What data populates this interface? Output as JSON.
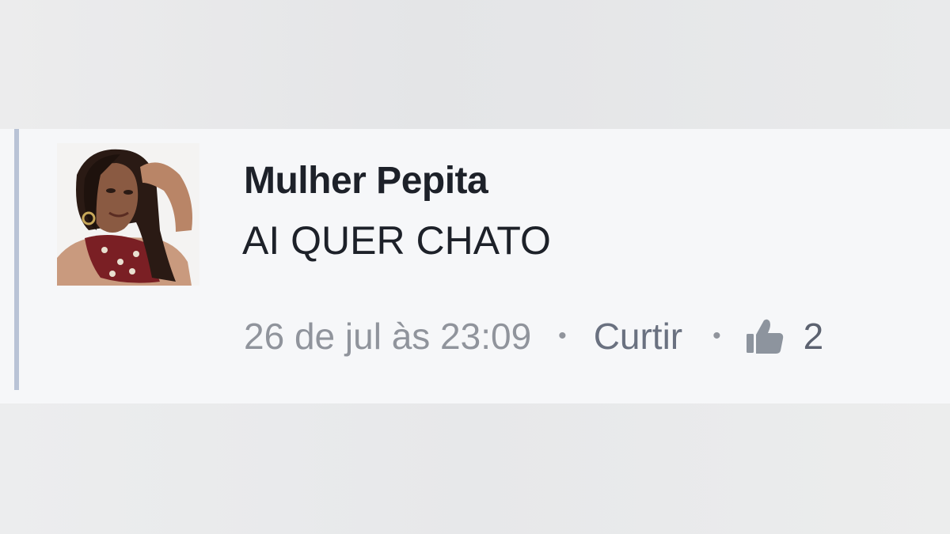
{
  "comment": {
    "author": "Mulher Pepita",
    "text": "AI QUER CHATO",
    "timestamp": "26 de jul às 23:09",
    "separator": "•",
    "like_label": "Curtir",
    "like_icon": "thumbs-up-icon",
    "like_count": "2"
  },
  "colors": {
    "thread_line": "#b9c3d6",
    "author_text": "#1d2129",
    "meta_text": "#90949c",
    "background": "#f6f7f9"
  }
}
